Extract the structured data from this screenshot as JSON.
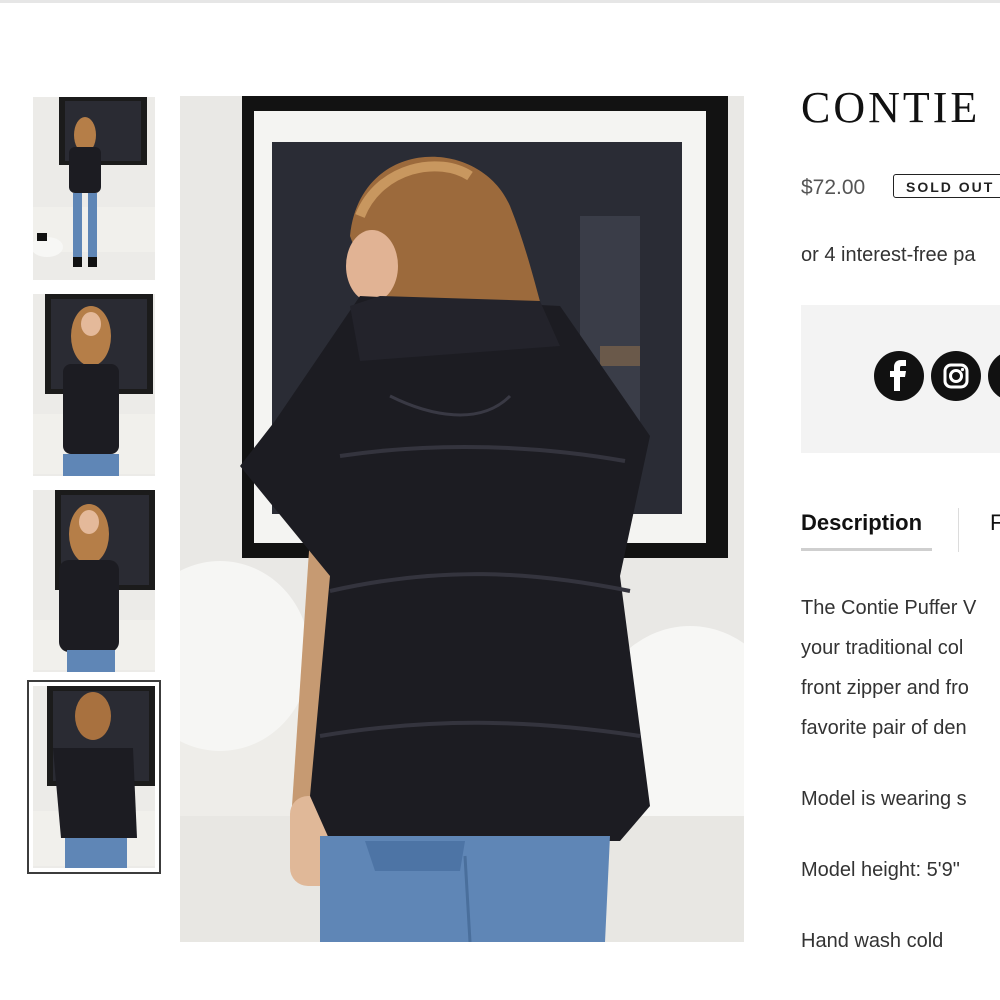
{
  "product": {
    "title": "CONTIE",
    "price": "$72.00",
    "badge": "SOLD OUT",
    "installments": "or 4 interest-free pa"
  },
  "share": {
    "icons": [
      "facebook-icon",
      "instagram-icon",
      "social-icon"
    ]
  },
  "tabs": [
    {
      "label": "Description"
    },
    {
      "label": "F"
    }
  ],
  "description": {
    "lines": [
      "The Contie Puffer V",
      "your traditional col",
      "front zipper and fro",
      "favorite pair of den"
    ],
    "model_wearing": "Model is wearing s",
    "model_height": "Model height: 5'9\"",
    "care": "Hand wash cold"
  },
  "colors": {
    "vest": "#1c1c22",
    "denim": "#5f86b6",
    "sweater": "#c69a72",
    "hair": "#9c6a3c"
  }
}
